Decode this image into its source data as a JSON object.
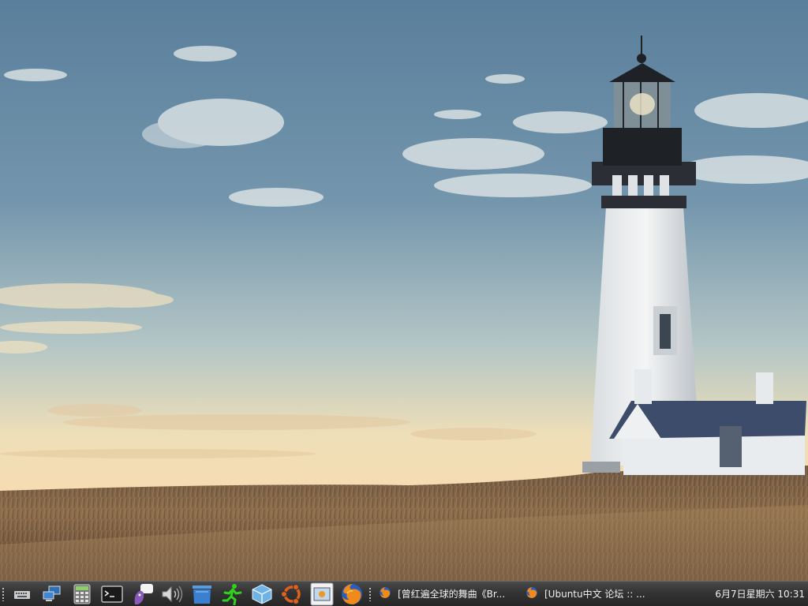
{
  "desktop": {
    "wallpaper": "lighthouse-on-grassland",
    "sky_color_top": "#5f86a3",
    "sky_color_horizon": "#f3dcb4",
    "grass_color": "#8a6a4a"
  },
  "taskbar": {
    "background": "#333333",
    "launchers": [
      {
        "name": "show-desktop",
        "icon": "keyboard-icon"
      },
      {
        "name": "network",
        "icon": "network-icon"
      },
      {
        "name": "calculator",
        "icon": "calculator-icon"
      },
      {
        "name": "terminal",
        "icon": "terminal-icon"
      },
      {
        "name": "pidgin",
        "icon": "pidgin-icon"
      },
      {
        "name": "volume",
        "icon": "volume-icon"
      },
      {
        "name": "trash",
        "icon": "trash-icon"
      },
      {
        "name": "run",
        "icon": "running-man-icon"
      },
      {
        "name": "virtualbox",
        "icon": "virtualbox-icon"
      },
      {
        "name": "ubuntu",
        "icon": "ubuntu-icon"
      },
      {
        "name": "screenshot",
        "icon": "screenshot-icon"
      },
      {
        "name": "firefox",
        "icon": "firefox-icon"
      }
    ],
    "tasks": [
      {
        "label": "[曾红遍全球的舞曲《Br...",
        "icon": "firefox-icon"
      },
      {
        "label": "[Ubuntu中文 论坛 :: ...",
        "icon": "firefox-icon"
      }
    ],
    "clock": "6月7日星期六  10:31"
  }
}
